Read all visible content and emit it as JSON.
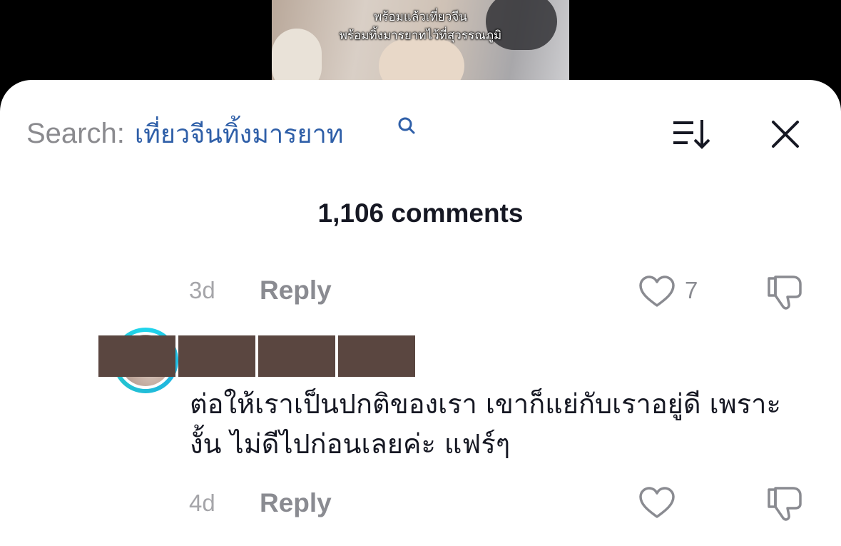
{
  "video": {
    "caption_line1": "พร้อมแล้วเที่ยวจีน",
    "caption_line2": "พร้อมทิ้งมารยาทไว้ที่สุวรรณภูมิ"
  },
  "search": {
    "prefix": "Search:",
    "query": "เที่ยวจีนทิ้งมารยาท"
  },
  "comments_header": {
    "count_label": "1,106 comments"
  },
  "comments": [
    {
      "time": "3d",
      "reply_label": "Reply",
      "likes": "7"
    },
    {
      "text": "ต่อให้เราเป็นปกติของเรา เขาก็แย่กับเราอยู่ดี เพราะงั้น ไม่ดีไปก่อนเลยค่ะ แฟร์ๆ",
      "time": "4d",
      "reply_label": "Reply",
      "likes": ""
    }
  ],
  "colors": {
    "accent_link": "#2f5fa8",
    "avatar_ring": "#20d5ec",
    "redaction": "#5a4640"
  }
}
